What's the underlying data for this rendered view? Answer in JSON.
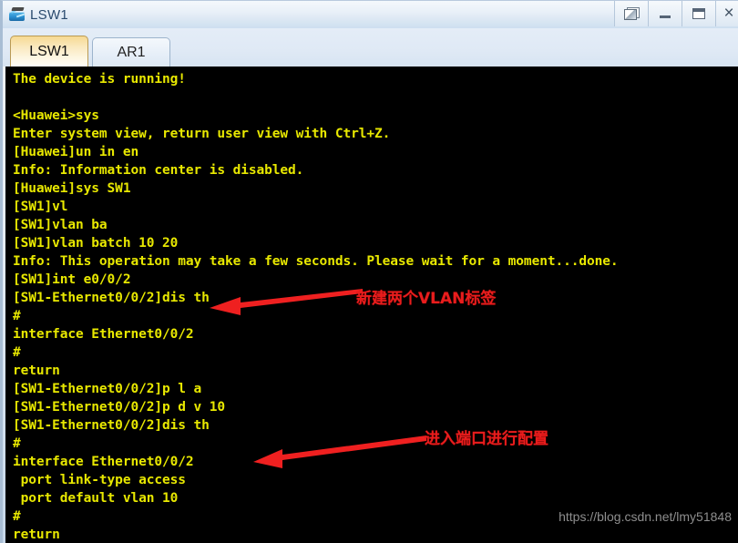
{
  "window": {
    "title": "LSW1",
    "icon": "switch-icon",
    "controls": [
      {
        "name": "restore-window-button",
        "icon": "restore-icon",
        "label": ""
      },
      {
        "name": "minimize-window-button",
        "icon": "minimize-icon",
        "label": ""
      },
      {
        "name": "maximize-window-button",
        "icon": "maximize-icon",
        "label": ""
      },
      {
        "name": "close-window-button",
        "icon": "close-icon",
        "label": "×"
      }
    ]
  },
  "tabs": [
    {
      "label": "LSW1",
      "active": true
    },
    {
      "label": "AR1",
      "active": false
    }
  ],
  "terminal": {
    "foreground": "#e8e800",
    "background": "#000000",
    "lines": [
      "The device is running!",
      "",
      "<Huawei>sys",
      "Enter system view, return user view with Ctrl+Z.",
      "[Huawei]un in en",
      "Info: Information center is disabled.",
      "[Huawei]sys SW1",
      "[SW1]vl",
      "[SW1]vlan ba",
      "[SW1]vlan batch 10 20",
      "Info: This operation may take a few seconds. Please wait for a moment...done.",
      "[SW1]int e0/0/2",
      "[SW1-Ethernet0/0/2]dis th",
      "#",
      "interface Ethernet0/0/2",
      "#",
      "return",
      "[SW1-Ethernet0/0/2]p l a",
      "[SW1-Ethernet0/0/2]p d v 10",
      "[SW1-Ethernet0/0/2]dis th",
      "#",
      "interface Ethernet0/0/2",
      " port link-type access",
      " port default vlan 10",
      "#",
      "return"
    ]
  },
  "annotations": {
    "color": "#e81d1d",
    "items": [
      {
        "label": "新建两个VLAN标签",
        "target_line": "[SW1]vlan batch 10 20"
      },
      {
        "label": "进入端口进行配置",
        "target_line": "[SW1-Ethernet0/0/2]p l a"
      }
    ]
  },
  "watermark": {
    "text": "https://blog.csdn.net/lmy51848",
    "color": "#8e8e8e"
  }
}
